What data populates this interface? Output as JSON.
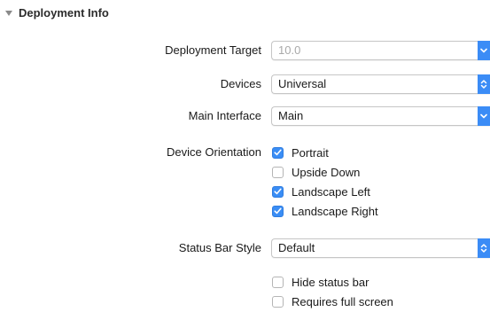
{
  "section": {
    "title": "Deployment Info"
  },
  "deployment_target": {
    "label": "Deployment Target",
    "value": "10.0",
    "enabled": false
  },
  "devices": {
    "label": "Devices",
    "value": "Universal"
  },
  "main_interface": {
    "label": "Main Interface",
    "value": "Main"
  },
  "device_orientation": {
    "label": "Device Orientation",
    "options": [
      {
        "label": "Portrait",
        "checked": true
      },
      {
        "label": "Upside Down",
        "checked": false
      },
      {
        "label": "Landscape Left",
        "checked": true
      },
      {
        "label": "Landscape Right",
        "checked": true
      }
    ]
  },
  "status_bar_style": {
    "label": "Status Bar Style",
    "value": "Default"
  },
  "options": [
    {
      "label": "Hide status bar",
      "checked": false
    },
    {
      "label": "Requires full screen",
      "checked": false
    }
  ],
  "colors": {
    "accent": "#3b8cf6",
    "disabled_text": "#a9a9a9"
  },
  "icons": {
    "combo_arrow": "chevron-down-icon",
    "popup_arrow": "up-down-arrows-icon",
    "check": "checkmark-icon",
    "disclosure": "disclosure-triangle-icon"
  }
}
